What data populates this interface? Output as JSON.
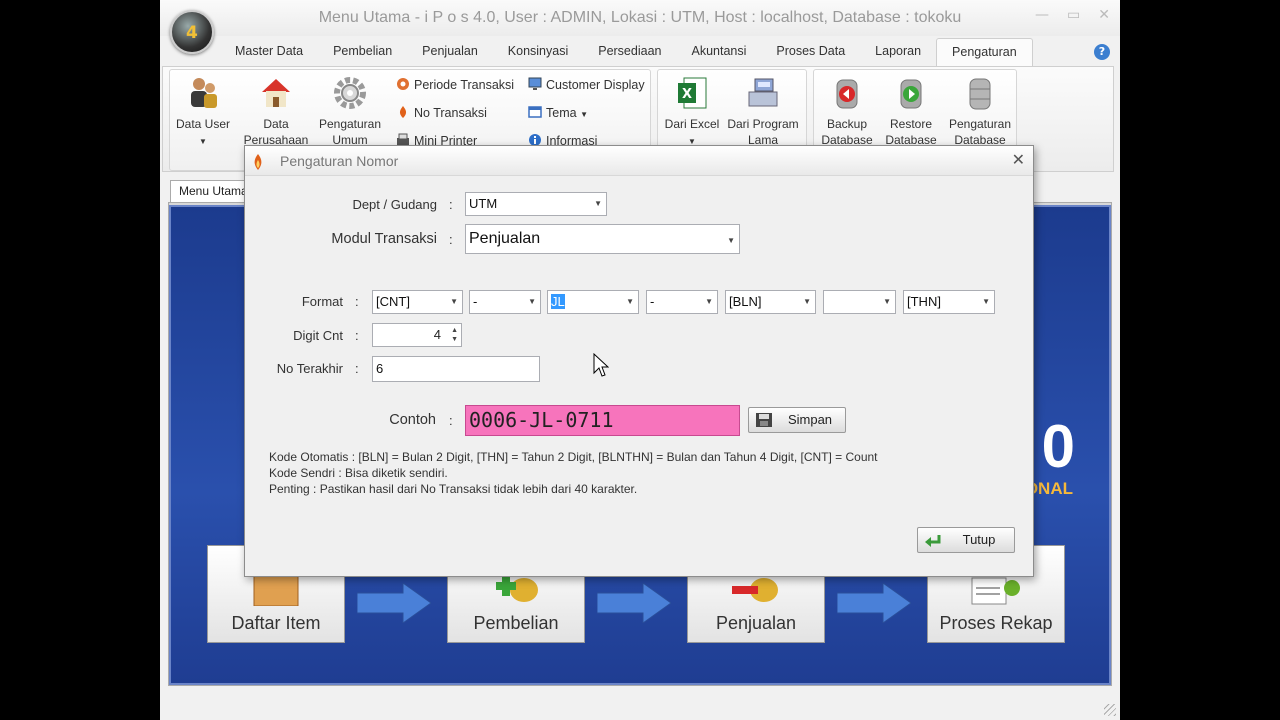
{
  "window": {
    "title": "Menu Utama - i P o s 4.0,  User : ADMIN, Lokasi : UTM, Host : localhost, Database : tokoku",
    "logo_text": "4",
    "controls": [
      "—",
      "▭",
      "✕"
    ]
  },
  "ribbon": {
    "tabs": [
      "Master Data",
      "Pembelian",
      "Penjualan",
      "Konsinyasi",
      "Persediaan",
      "Akuntansi",
      "Proses Data",
      "Laporan",
      "Pengaturan"
    ],
    "active_tab": "Pengaturan",
    "help": "?",
    "group1": {
      "data_user": "Data User",
      "data_perusahaan_1": "Data",
      "data_perusahaan_2": "Perusahaan",
      "pengaturan_umum_1": "Pengaturan",
      "pengaturan_umum_2": "Umum",
      "periode_transaksi": "Periode Transaksi",
      "no_transaksi": "No Transaksi",
      "mini_printer": "Mini Printer",
      "customer_display": "Customer Display",
      "tema": "Tema",
      "informasi": "Informasi"
    },
    "group2": {
      "dari_excel": "Dari Excel",
      "dari_program_1": "Dari Program",
      "dari_program_2": "Lama"
    },
    "group3": {
      "backup_1": "Backup",
      "backup_2": "Database",
      "restore_1": "Restore",
      "restore_2": "Database",
      "pengaturan_db_1": "Pengaturan",
      "pengaturan_db_2": "Database"
    }
  },
  "document_tab": "Menu Utama",
  "background": {
    "brand_big": "0",
    "brand_small": "ONAL",
    "flow": [
      "Daftar Item",
      "Pembelian",
      "Penjualan",
      "Proses Rekap"
    ]
  },
  "dialog": {
    "title": "Pengaturan Nomor",
    "close": "✕",
    "dept_label": "Dept / Gudang",
    "dept_value": "UTM",
    "modul_label": "Modul Transaksi",
    "modul_value": "Penjualan",
    "format_label": "Format",
    "format_values": [
      "[CNT]",
      "-",
      "JL",
      "-",
      "[BLN]",
      "",
      "[THN]"
    ],
    "digit_label": "Digit Cnt",
    "digit_value": "4",
    "last_label": "No Terakhir",
    "last_value": "6",
    "contoh_label": "Contoh",
    "contoh_value": "0006-JL-0711",
    "simpan": "Simpan",
    "tutup": "Tutup",
    "info_1": "Kode Otomatis : [BLN] = Bulan 2 Digit, [THN] = Tahun 2 Digit, [BLNTHN] = Bulan dan Tahun 4 Digit, [CNT] = Count",
    "info_2": "Kode Sendri : Bisa diketik sendiri.",
    "info_3": "Penting : Pastikan hasil dari No Transaksi tidak lebih dari 40 karakter.",
    "colon": ":"
  },
  "colors": {
    "preview_bg": "#f774bc",
    "accent_blue": "#2a50ad",
    "selection": "#3399ff"
  }
}
